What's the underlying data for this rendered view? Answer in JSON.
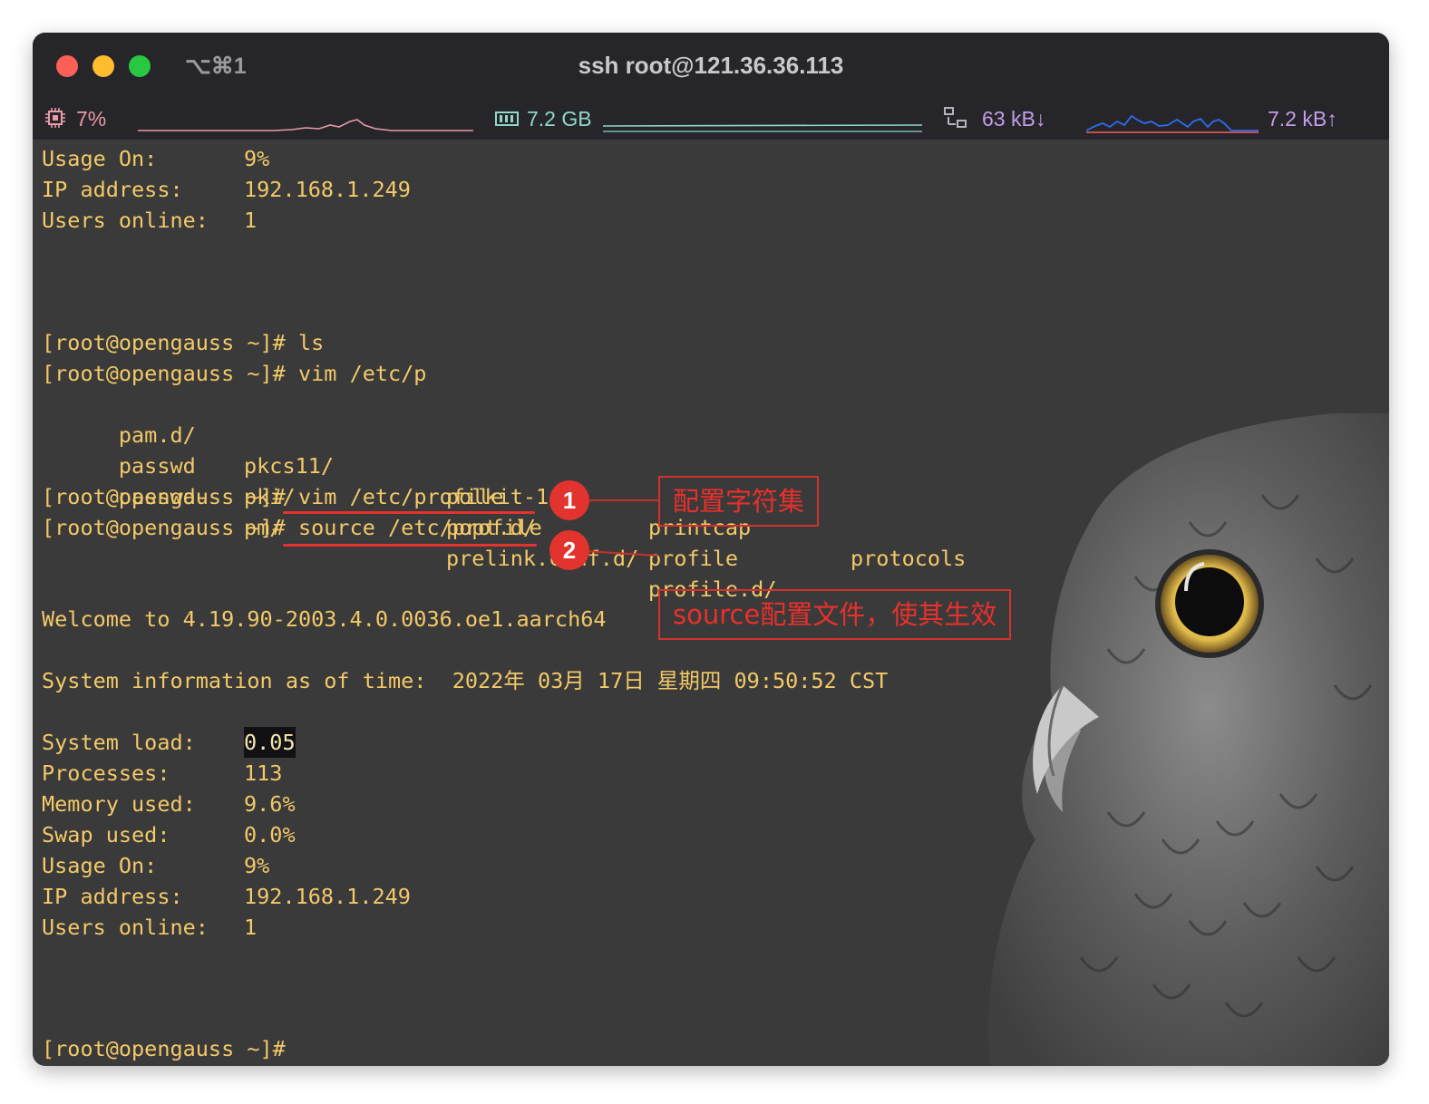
{
  "window": {
    "shortcut": "⌥⌘1",
    "title": "ssh root@121.36.36.113"
  },
  "status": {
    "cpu_icon": "cpu-chip-icon",
    "cpu": "7%",
    "memory_icon": "memory-icon",
    "memory": "7.2 GB",
    "network_icon": "network-icon",
    "net_down": "63 kB↓",
    "net_up": "7.2 kB↑",
    "colors": {
      "cpu": "#e89aa6",
      "memory": "#8fd8c8",
      "network": "#c49ce8"
    }
  },
  "terminal": {
    "text_color": "#f3c969",
    "background": "#3a3a3a",
    "top_info": [
      {
        "label": "Usage On:",
        "value": "9%"
      },
      {
        "label": "IP address:",
        "value": "192.168.1.249"
      },
      {
        "label": "Users online:",
        "value": "1"
      }
    ],
    "prompt": "[root@opengauss ~]#",
    "cmd_ls": " ls",
    "cmd_vim_partial": " vim /etc/p",
    "completions": [
      [
        "pam.d/",
        "pkcs11/",
        "polkit-1/",
        "printcap",
        "protocols"
      ],
      [
        "passwd",
        "pki/",
        "popt.d/",
        "profile",
        ""
      ],
      [
        "passwd-",
        "pm/",
        "prelink.conf.d/",
        "profile.d/",
        ""
      ]
    ],
    "cmd_vim": "vim /etc/profile",
    "cmd_source": "source /etc/profile",
    "welcome": "Welcome to 4.19.90-2003.4.0.0036.oe1.aarch64",
    "sysinfo": "System information as of time:  2022年 03月 17日 星期四 09:50:52 CST",
    "system_load_label": "System load:",
    "system_load_value": "0.05",
    "bottom_info": [
      {
        "label": "Processes:",
        "value": "113"
      },
      {
        "label": "Memory used:",
        "value": "9.6%"
      },
      {
        "label": "Swap used:",
        "value": "0.0%"
      },
      {
        "label": "Usage On:",
        "value": "9%"
      },
      {
        "label": "IP address:",
        "value": "192.168.1.249"
      },
      {
        "label": "Users online:",
        "value": "1"
      }
    ],
    "final_prompt": "[root@opengauss ~]#"
  },
  "annotations": {
    "color": "#e2332e",
    "step1_number": "1",
    "step1_text": "配置字符集",
    "step2_number": "2",
    "step2_text": "source配置文件，使其生效"
  },
  "background_image": "owl-photo"
}
